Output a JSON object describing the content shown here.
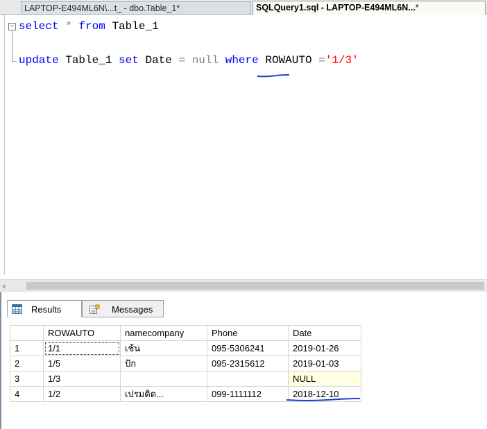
{
  "tabs": [
    {
      "label": "LAPTOP-E494ML6N\\...t_ - dbo.Table_1*",
      "active": false
    },
    {
      "label": "SQLQuery1.sql - LAPTOP-E494ML6N...",
      "dirty_mark": "*",
      "active": true
    }
  ],
  "editor": {
    "line1": {
      "kw1": "select",
      "op": "*",
      "kw2": "from",
      "table": "Table_1"
    },
    "line2": {
      "kw1": "update",
      "table": "Table_1",
      "kw2": "set",
      "col": "Date",
      "eq": "=",
      "nullword": "null",
      "kw3": "where",
      "col2": "ROWAUTO",
      "eq2": "=",
      "val": "'1/3'"
    },
    "fold_glyph": "−"
  },
  "scrollbar": {
    "left_arrow": "‹"
  },
  "results_tabs": [
    {
      "label": "Results",
      "icon": "grid-icon",
      "active": true
    },
    {
      "label": "Messages",
      "icon": "messages-icon",
      "active": false
    }
  ],
  "grid": {
    "columns": [
      "",
      "ROWAUTO",
      "namecompany",
      "Phone",
      "Date"
    ],
    "rows": [
      {
        "n": "1",
        "rowauto": "1/1",
        "namecompany": "เช้น",
        "phone": "095-5306241",
        "date": "2019-01-26"
      },
      {
        "n": "2",
        "rowauto": "1/5",
        "namecompany": "ปัก",
        "phone": "095-2315612",
        "date": "2019-01-03"
      },
      {
        "n": "3",
        "rowauto": "1/3",
        "namecompany": "",
        "phone": "",
        "date": "NULL"
      },
      {
        "n": "4",
        "rowauto": "1/2",
        "namecompany": "เปรมดิด...",
        "phone": "099-1111112",
        "date": "2018-12-10"
      }
    ]
  },
  "colors": {
    "keyword": "#0000ff",
    "string": "#ff0000",
    "operator": "#808080",
    "annotation": "#1a3fd1",
    "null_highlight": "#ffffe1"
  }
}
